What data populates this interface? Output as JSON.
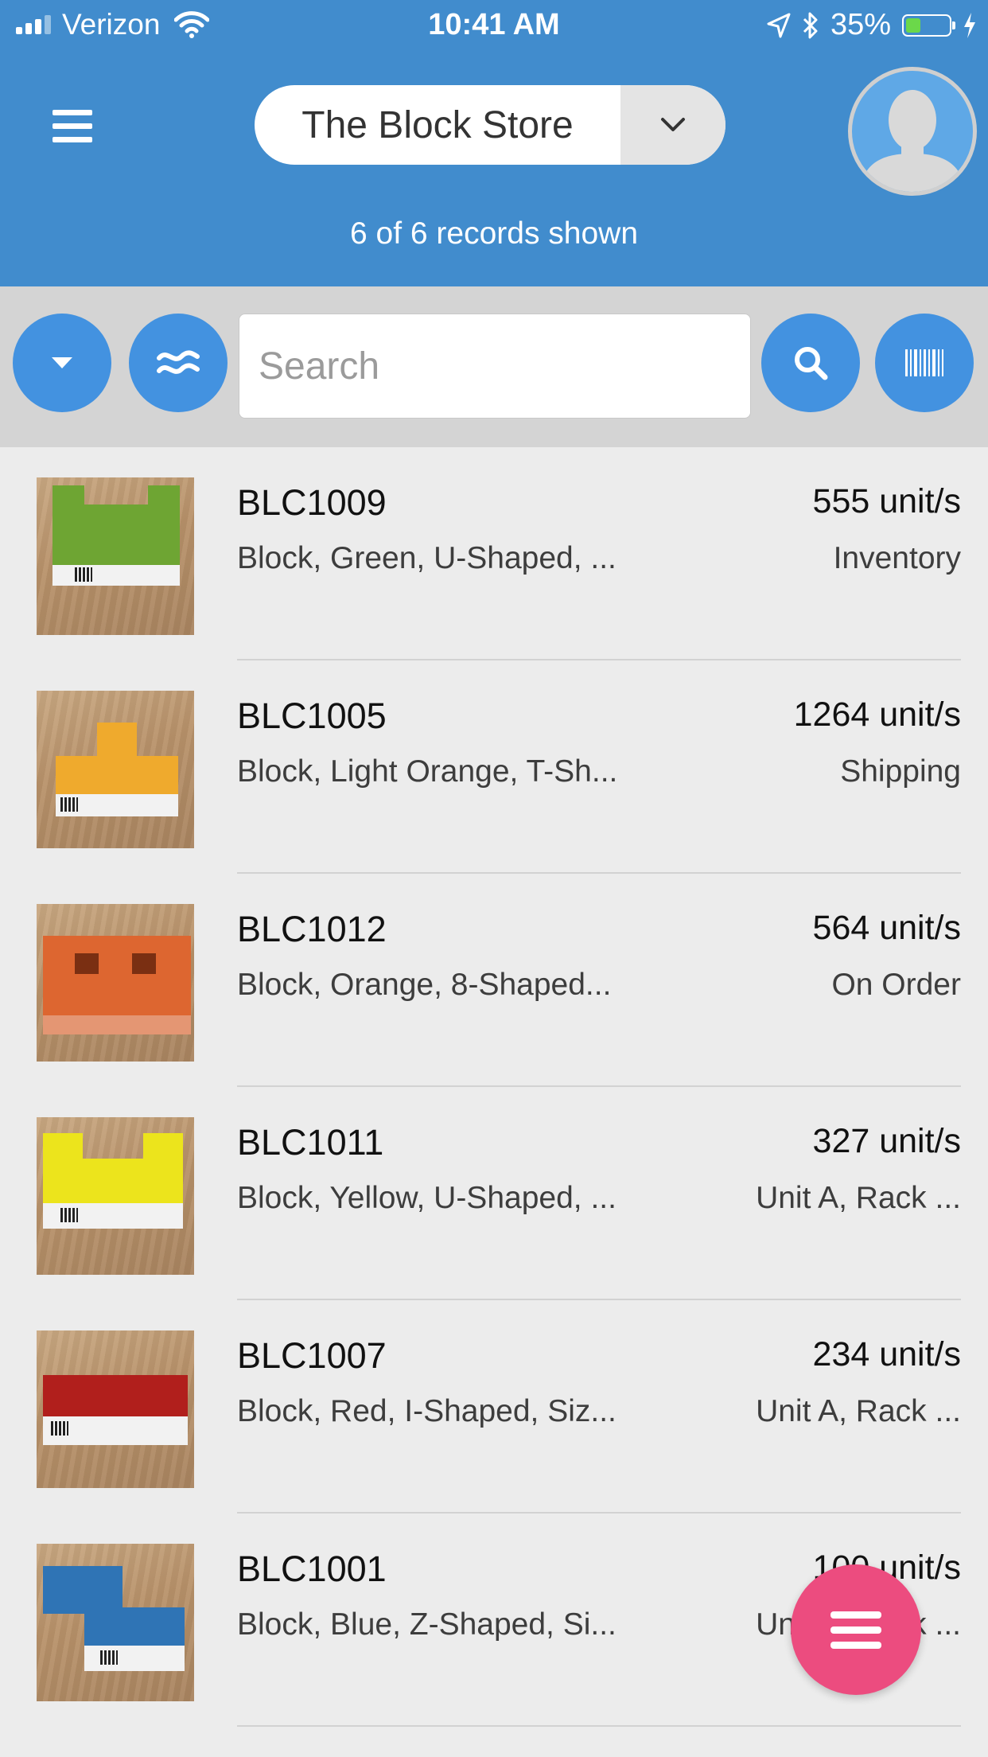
{
  "status_bar": {
    "carrier": "Verizon",
    "time": "10:41 AM",
    "battery": "35%",
    "battery_level": 0.35
  },
  "header": {
    "store_name": "The Block Store",
    "records_text": "6 of 6 records shown"
  },
  "toolbar": {
    "search_placeholder": "Search",
    "search_value": ""
  },
  "items": [
    {
      "sku": "BLC1009",
      "desc": "Block, Green, U-Shaped, ...",
      "qty": "555 unit/s",
      "location": "Inventory",
      "color": "#6ea533",
      "shape": "U-Shaped"
    },
    {
      "sku": "BLC1005",
      "desc": "Block, Light Orange, T-Sh...",
      "qty": "1264 unit/s",
      "location": "Shipping",
      "color": "#efaa2d",
      "shape": "T-Shaped"
    },
    {
      "sku": "BLC1012",
      "desc": "Block, Orange, 8-Shaped...",
      "qty": "564 unit/s",
      "location": "On Order",
      "color": "#dd6630",
      "shape": "8-Shaped"
    },
    {
      "sku": "BLC1011",
      "desc": "Block, Yellow, U-Shaped, ...",
      "qty": "327 unit/s",
      "location": "Unit A, Rack ...",
      "color": "#ece41c",
      "shape": "U-Shaped"
    },
    {
      "sku": "BLC1007",
      "desc": "Block, Red, I-Shaped, Siz...",
      "qty": "234 unit/s",
      "location": "Unit A, Rack ...",
      "color": "#b11f1c",
      "shape": "I-Shaped"
    },
    {
      "sku": "BLC1001",
      "desc": "Block, Blue, Z-Shaped, Si...",
      "qty": "100 unit/s",
      "location": "Unit A, Rack ...",
      "color": "#2f74b5",
      "shape": "Z-Shaped"
    }
  ],
  "icons": {
    "menu": "hamburger-icon",
    "store_dropdown": "chevron-down-icon",
    "avatar": "user-silhouette-icon",
    "sort": "caret-down-icon",
    "fuzzy": "approx-equal-icon",
    "search": "magnifier-icon",
    "barcode": "barcode-icon",
    "fab": "hamburger-icon"
  },
  "colors": {
    "header": "#418ccd",
    "button": "#4392e0",
    "fab": "#ec4c7f"
  }
}
